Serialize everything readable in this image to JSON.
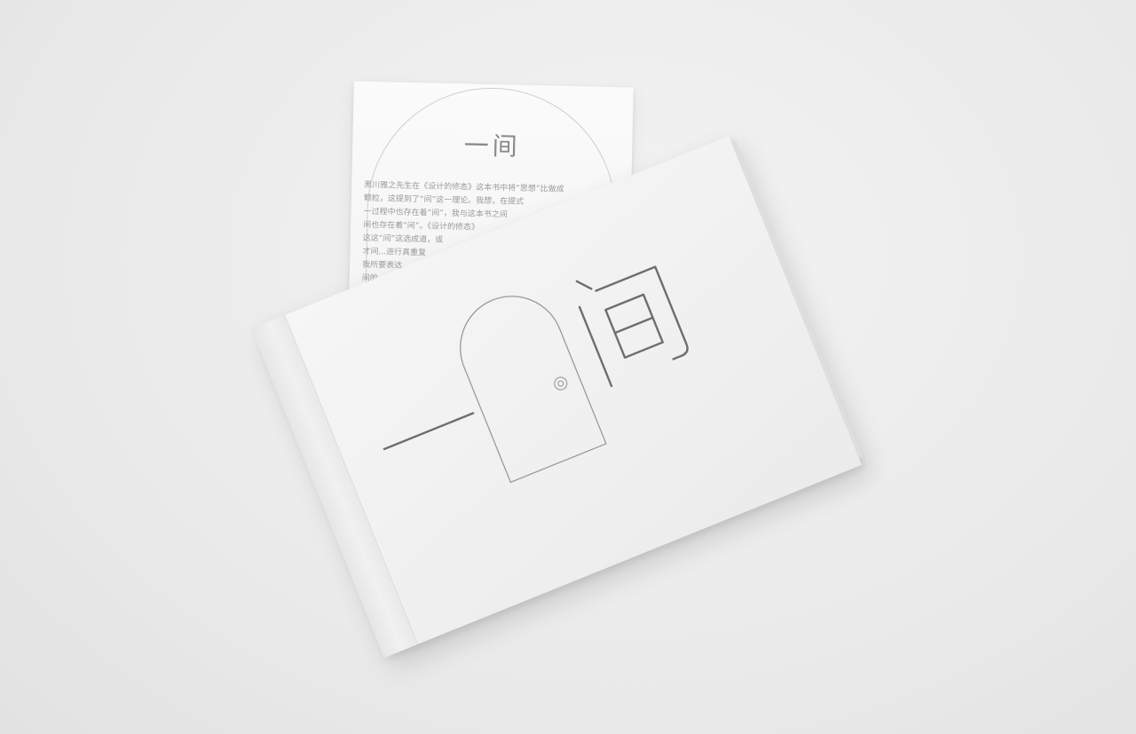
{
  "cover": {
    "title": "一间"
  },
  "insert_card": {
    "title": "一间",
    "text_lines": [
      "黑川雅之先生在《设计的修态》这本书中将“思想”比做成",
      "颗粒，这提到了“间”这一理论。我想，在提式",
      "一过程中也存在着“间”，我与这本书之间",
      "间也存在着“间”。《设计的修态》",
      "这这“间”这选成道，或",
      "才间...进行真重复",
      "我所要表达",
      "间的"
    ]
  },
  "colors": {
    "background": "#ebebeb",
    "paper": "#f4f4f4",
    "ink": "#6e6e6e",
    "door_line": "#9a9a9a"
  },
  "icons": {
    "door": "door-icon"
  }
}
